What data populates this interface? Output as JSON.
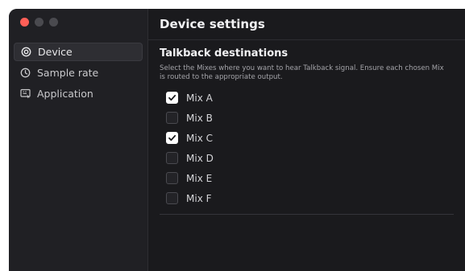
{
  "window": {
    "traffic_lights": [
      {
        "name": "close",
        "color": "#ff5f57"
      },
      {
        "name": "minimize",
        "color": "#4a4a4f"
      },
      {
        "name": "zoom",
        "color": "#4a4a4f"
      }
    ]
  },
  "sidebar": {
    "items": [
      {
        "label": "Device",
        "icon": "device-icon",
        "active": true
      },
      {
        "label": "Sample rate",
        "icon": "clock-icon",
        "active": false
      },
      {
        "label": "Application",
        "icon": "application-icon",
        "active": false
      }
    ]
  },
  "header": {
    "title": "Device settings"
  },
  "talkback": {
    "title": "Talkback destinations",
    "description": "Select the Mixes where you want to hear Talkback signal. Ensure each chosen Mix is routed to the appropriate output.",
    "mixes": [
      {
        "label": "Mix A",
        "checked": true
      },
      {
        "label": "Mix B",
        "checked": false
      },
      {
        "label": "Mix C",
        "checked": true
      },
      {
        "label": "Mix D",
        "checked": false
      },
      {
        "label": "Mix E",
        "checked": false
      },
      {
        "label": "Mix F",
        "checked": false
      }
    ]
  },
  "colors": {
    "background": "#1a1a1d",
    "sidebar": "#202024",
    "accent_close": "#ff5f57",
    "check": "#ffffff"
  }
}
